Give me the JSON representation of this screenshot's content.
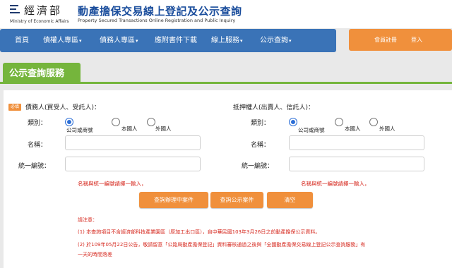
{
  "header": {
    "logo_name": "經濟部",
    "logo_en": "Ministry of Economic Affairs",
    "site_title": "動產擔保交易線上登記及公示查詢",
    "site_subtitle": "Property Secured Transactions Online Registration and Public Inquiry"
  },
  "nav": {
    "items": [
      {
        "label": "首頁",
        "caret": ""
      },
      {
        "label": "債權人專區",
        "caret": "▾"
      },
      {
        "label": "債務人專區",
        "caret": "▾"
      },
      {
        "label": "應附書件下載",
        "caret": ""
      },
      {
        "label": "線上服務",
        "caret": "▾"
      },
      {
        "label": "公示查詢",
        "caret": "▾"
      }
    ],
    "member_register": "會員註冊",
    "member_login": "登入",
    "bar_color": "#3a73b7",
    "member_color": "#f0903c"
  },
  "section": {
    "title": "公示查詢服務",
    "color": "#75b53c"
  },
  "form": {
    "badge": "必填",
    "debtor": {
      "title": "債務人(買受人、受託人)：",
      "category_label": "類別：",
      "options": [
        "公司或商號",
        "本國人",
        "外國人"
      ],
      "selected": "公司或商號",
      "name_label": "名稱：",
      "name_value": "",
      "id_label": "統一編號：",
      "id_value": "",
      "hint": "名稱與統一編號請擇一輸入，"
    },
    "mortgagor": {
      "title": "抵押權人(出賣人、信託人)：",
      "category_label": "類別：",
      "options": [
        "公司或商號",
        "本國人",
        "外國人"
      ],
      "selected": "公司或商號",
      "name_label": "名稱：",
      "name_value": "",
      "id_label": "統一編號：",
      "id_value": "",
      "hint": "名稱與統一編號請擇一輸入，"
    },
    "buttons": {
      "pending": "查詢辦理中案件",
      "public": "查詢公示案件",
      "clear": "清空"
    },
    "notes": {
      "heading": "請注意：",
      "line1": "(1) 本查詢項目不含經濟部科技產業園區（原加工出口區），自中華民國103年3月26日之前動產擔保公示資料。",
      "line2": "(2) 於109年05月22日公告，敬請留意「公路局動產擔保登記」資料審核通過之後與「全國動產擔保交易線上登記公示查詢服務」有",
      "line3": "一天的時間落差"
    },
    "hint_color": "#d6291f",
    "radio_color": "#2c6ed6"
  }
}
